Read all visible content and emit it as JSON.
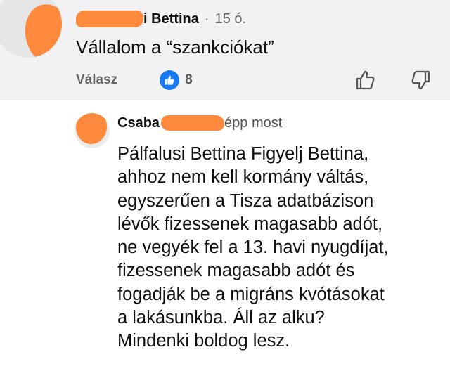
{
  "top_comment": {
    "author_visible": "i Bettina",
    "separator": "·",
    "time": "15 ó.",
    "text": "Vállalom a “szankciókat”",
    "reply_label": "Válasz",
    "like_count": "8",
    "icons": [
      "like-badge-icon",
      "thumbs-up-icon",
      "thumbs-down-icon"
    ]
  },
  "reply_comment": {
    "author_visible": "Csaba",
    "time_visible": "épp most",
    "lines": [
      "Pálfalusi Bettina Figyelj Bettina,",
      "ahhoz nem kell kormány váltás,",
      "egyszerűen a Tisza adatbázison",
      "lévők fizessenek magasabb adót,",
      "ne vegyék fel a 13. havi nyugdíjat,",
      "fizessenek magasabb adót és",
      "fogadják be a migráns kvótásokat",
      "a lakásunkba. Áll az alku?",
      "Mindenki boldog lesz."
    ]
  },
  "colors": {
    "top_background": "#f2f2f4",
    "like_blue": "#1877f2",
    "redaction_orange": "#ff8a3d"
  }
}
